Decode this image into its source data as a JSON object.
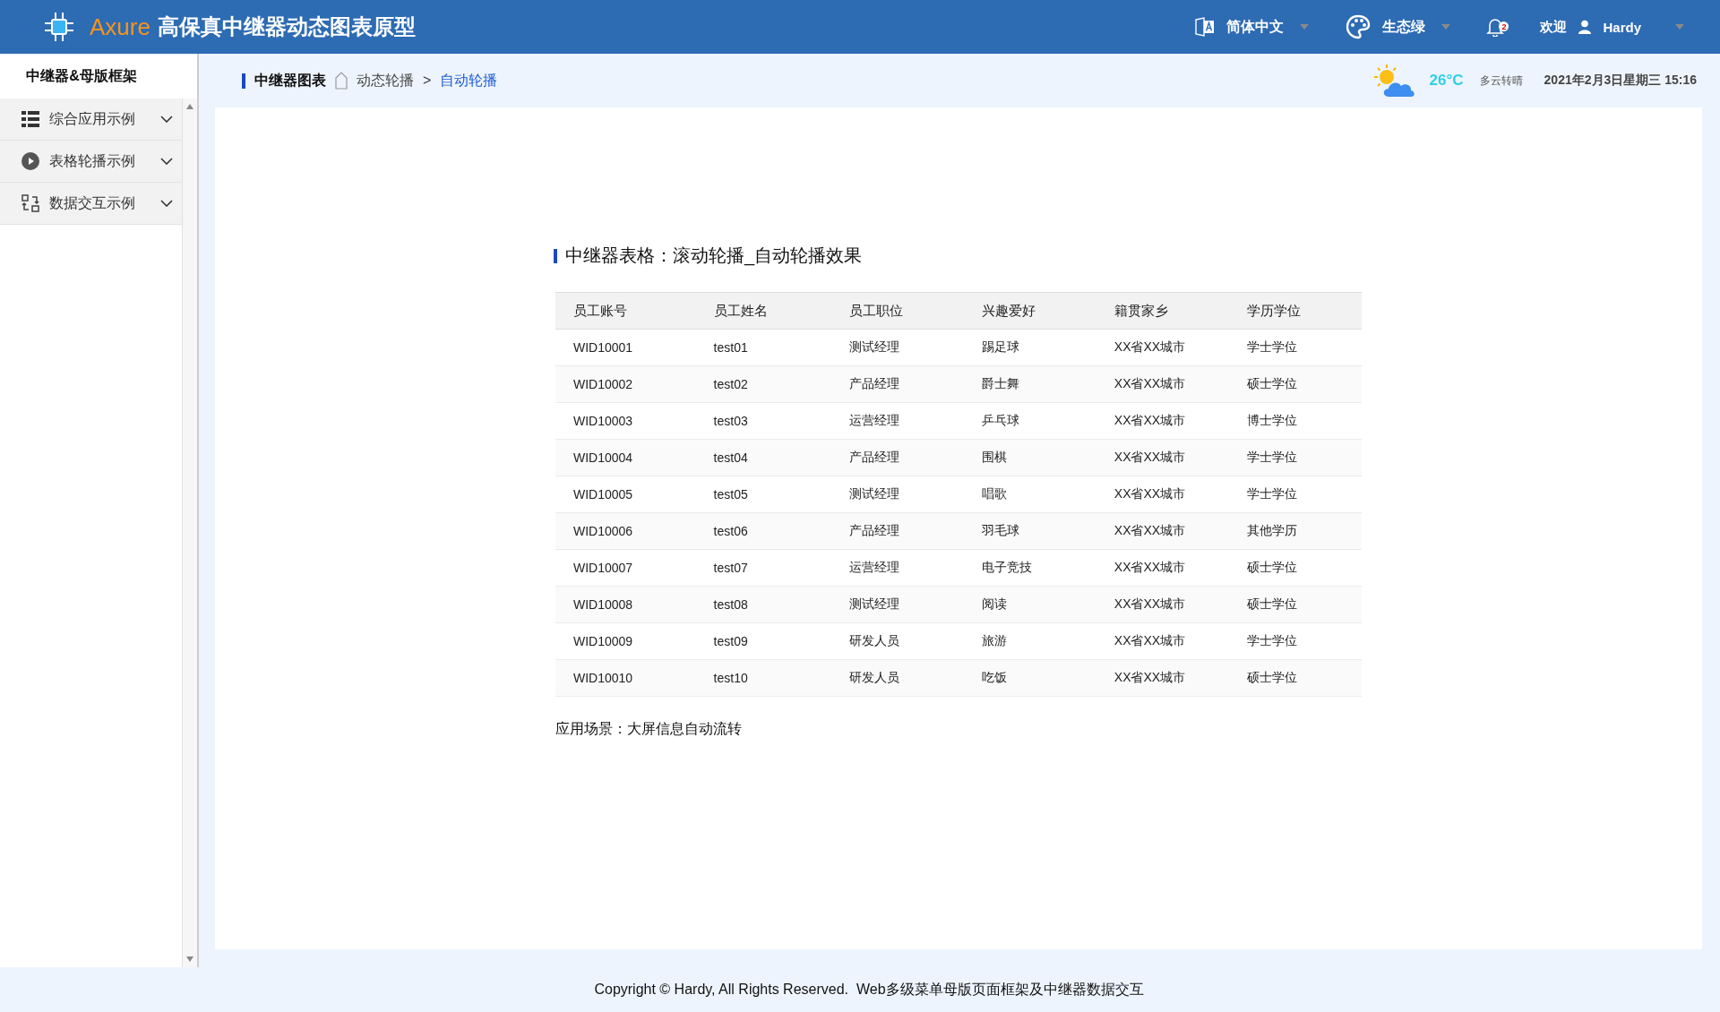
{
  "header": {
    "brand": "Axure",
    "title": "高保真中继器动态图表原型",
    "language": "简体中文",
    "theme": "生态绿",
    "notification_count": "2",
    "welcome": "欢迎",
    "user": "Hardy"
  },
  "sidebar": {
    "title": "中继器&母版框架",
    "items": [
      {
        "label": "综合应用示例",
        "expanded": false
      },
      {
        "label": "表格轮播示例",
        "expanded": false
      },
      {
        "label": "数据交互示例",
        "expanded": false
      }
    ]
  },
  "breadcrumb": {
    "root": "中继器图表",
    "items": [
      {
        "label": "动态轮播",
        "selected": false
      },
      {
        "label": "自动轮播",
        "selected": true
      }
    ],
    "separator": ">"
  },
  "weather": {
    "temperature": "26°C",
    "condition": "多云转晴",
    "datetime": "2021年2月3日星期三 15:16"
  },
  "panel": {
    "title": "中继器表格：滚动轮播_自动轮播效果",
    "table": {
      "columns": [
        "员工账号",
        "员工姓名",
        "员工职位",
        "兴趣爱好",
        "籍贯家乡",
        "学历学位"
      ],
      "rows": [
        [
          "WID10001",
          "test01",
          "测试经理",
          "踢足球",
          "XX省XX城市",
          "学士学位"
        ],
        [
          "WID10002",
          "test02",
          "产品经理",
          "爵士舞",
          "XX省XX城市",
          "硕士学位"
        ],
        [
          "WID10003",
          "test03",
          "运营经理",
          "乒乓球",
          "XX省XX城市",
          "博士学位"
        ],
        [
          "WID10004",
          "test04",
          "产品经理",
          "围棋",
          "XX省XX城市",
          "学士学位"
        ],
        [
          "WID10005",
          "test05",
          "测试经理",
          "唱歌",
          "XX省XX城市",
          "学士学位"
        ],
        [
          "WID10006",
          "test06",
          "产品经理",
          "羽毛球",
          "XX省XX城市",
          "其他学历"
        ],
        [
          "WID10007",
          "test07",
          "运营经理",
          "电子竞技",
          "XX省XX城市",
          "硕士学位"
        ],
        [
          "WID10008",
          "test08",
          "测试经理",
          "阅读",
          "XX省XX城市",
          "硕士学位"
        ],
        [
          "WID10009",
          "test09",
          "研发人员",
          "旅游",
          "XX省XX城市",
          "学士学位"
        ],
        [
          "WID10010",
          "test10",
          "研发人员",
          "吃饭",
          "XX省XX城市",
          "硕士学位"
        ]
      ]
    },
    "note": "应用场景：大屏信息自动流转"
  },
  "footer": "Copyright © Hardy, All Rights Reserved.  Web多级菜单母版页面框架及中继器数据交互"
}
